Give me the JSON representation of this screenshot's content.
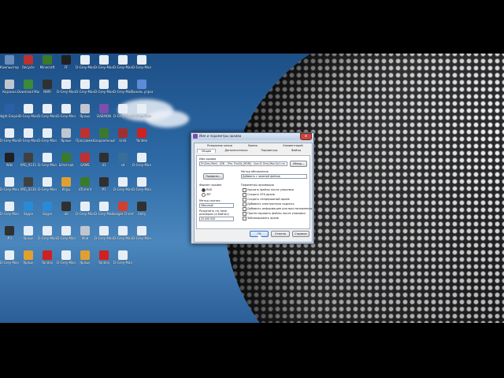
{
  "desktop": {
    "icons": [
      {
        "label": "Компьютер",
        "color": "#6b8fb8"
      },
      {
        "label": "Recycle",
        "color": "#c03030"
      },
      {
        "label": "Minecraft",
        "color": "#3b7a2a"
      },
      {
        "label": "FF",
        "color": "#202020"
      },
      {
        "label": "D-Grey-Man",
        "color": "#e8eef6"
      },
      {
        "label": "D-Grey-Man",
        "color": "#e8eef6"
      },
      {
        "label": "D-Grey-Man",
        "color": "#e8eef6"
      },
      {
        "label": "D-Grey-Man",
        "color": "#e8eef6"
      },
      {
        "label": "Корзина",
        "color": "#c0c6cf"
      },
      {
        "label": "Download Master",
        "color": "#3a8a3a"
      },
      {
        "label": "NWR",
        "color": "#303030"
      },
      {
        "label": "D-Grey-Man",
        "color": "#e8eef6"
      },
      {
        "label": "D-Grey-Man",
        "color": "#e8eef6"
      },
      {
        "label": "D-Grey-Man",
        "color": "#e8eef6"
      },
      {
        "label": "D-Grey-Man",
        "color": "#e8eef6"
      },
      {
        "label": "Панель управления",
        "color": "#5b8dd6"
      },
      {
        "label": "Night Empire",
        "color": "#2b5fa8"
      },
      {
        "label": "D-Grey-Man",
        "color": "#e8eef6"
      },
      {
        "label": "D-Grey-Man",
        "color": "#e8eef6"
      },
      {
        "label": "D-Grey-Man",
        "color": "#e8eef6"
      },
      {
        "label": "Ярлык",
        "color": "#c0c6cf"
      },
      {
        "label": "DAEMON",
        "color": "#7a4fb0"
      },
      {
        "label": "D-Grey-Man",
        "color": "#e8eef6"
      },
      {
        "label": "D-Grey-Man",
        "color": "#e8eef6"
      },
      {
        "label": "D-Grey-Man",
        "color": "#e8eef6"
      },
      {
        "label": "D-Grey-Man",
        "color": "#e8eef6"
      },
      {
        "label": "D-Grey-Man",
        "color": "#e8eef6"
      },
      {
        "label": "Ярлык",
        "color": "#c0c6cf"
      },
      {
        "label": "Программа",
        "color": "#c03030"
      },
      {
        "label": "Сохранённый",
        "color": "#3b7a2a"
      },
      {
        "label": "kraS",
        "color": "#a03030"
      },
      {
        "label": "Yandex",
        "color": "#d02020"
      },
      {
        "label": "Wiki",
        "color": "#202020"
      },
      {
        "label": "IMG_0135",
        "color": "#404040"
      },
      {
        "label": "D-Grey-Man",
        "color": "#e8eef6"
      },
      {
        "label": "Штатная",
        "color": "#3b7a2a"
      },
      {
        "label": "GAME",
        "color": "#c03030"
      },
      {
        "label": "d1",
        "color": "#303030"
      },
      {
        "label": "sd",
        "color": "#3a6e9a"
      },
      {
        "label": "D-Grey-Man",
        "color": "#e8eef6"
      },
      {
        "label": "D-Grey-Man",
        "color": "#e8eef6"
      },
      {
        "label": "IMG_0136",
        "color": "#404040"
      },
      {
        "label": "D-Grey-Man",
        "color": "#e8eef6"
      },
      {
        "label": "Игры",
        "color": "#e0a030"
      },
      {
        "label": "UTorrent",
        "color": "#3b7a2a"
      },
      {
        "label": "#1",
        "color": "#303030"
      },
      {
        "label": "D-Grey-Man",
        "color": "#e8eef6"
      },
      {
        "label": "D-Grey-Man",
        "color": "#e8eef6"
      },
      {
        "label": "D-Grey-Man",
        "color": "#e8eef6"
      },
      {
        "label": "Skype",
        "color": "#2a8ad6"
      },
      {
        "label": "Skype",
        "color": "#2a8ad6"
      },
      {
        "label": "dd",
        "color": "#303030"
      },
      {
        "label": "D-Grey-Man",
        "color": "#e8eef6"
      },
      {
        "label": "D-Grey-Man",
        "color": "#e8eef6"
      },
      {
        "label": "Google Chrome",
        "color": "#d04030"
      },
      {
        "label": "Unity",
        "color": "#303030"
      },
      {
        "label": "#3",
        "color": "#303030"
      },
      {
        "label": "Ярлык",
        "color": "#e8eef6"
      },
      {
        "label": "D-Grey-Man",
        "color": "#e8eef6"
      },
      {
        "label": "D-Grey-Man",
        "color": "#e8eef6"
      },
      {
        "label": "Мой",
        "color": "#c0c6cf"
      },
      {
        "label": "D-Grey-Man",
        "color": "#e8eef6"
      },
      {
        "label": "D-Grey-Man",
        "color": "#e8eef6"
      },
      {
        "label": "D-Grey-Man",
        "color": "#e8eef6"
      },
      {
        "label": "D-Grey-Man",
        "color": "#e8eef6"
      },
      {
        "label": "Ярлык",
        "color": "#e0a030"
      },
      {
        "label": "Yandex",
        "color": "#d02020"
      },
      {
        "label": "D-Grey-Man",
        "color": "#e8eef6"
      },
      {
        "label": "Ярлык",
        "color": "#e0a030"
      },
      {
        "label": "Yandex",
        "color": "#d02020"
      },
      {
        "label": "D-Grey-Man",
        "color": "#e8eef6"
      }
    ]
  },
  "dialog": {
    "title": "Имя и параметры архива",
    "close": "x",
    "tabs_row1": [
      "Резервные копии",
      "Время",
      "Комментарий"
    ],
    "tabs_row2": [
      "Общие",
      "Дополнительно",
      "Параметры",
      "Файлы"
    ],
    "archive_name_label": "Имя архива",
    "archive_name_value": "D:\\Grey-Man\\...\\DB ...\\Pro..Tra44t_[HDR]\\...\\kav-D-Grey-Man-Ep1.rar",
    "browse_button": "Обзор...",
    "profiles_button": "Профили...",
    "update_method_label": "Метод обновления",
    "update_method_value": "Добавить с заменой файлов",
    "format_label": "Формат архива",
    "format_options": [
      "RAR",
      "ZIP"
    ],
    "compression_label": "Метод сжатия",
    "compression_value": "Обычный",
    "split_label": "Разделить на тома размером (в байтах)",
    "split_value": "20 000 000",
    "archive_options_label": "Параметры архивации",
    "archive_options": [
      "Удалить файлы после упаковки",
      "Создать SFX-архив",
      "Создать непрерывный архив",
      "Добавить электронную подпись",
      "Добавить информацию для восстановления",
      "Протестировать файлы после упаковки",
      "Заблокировать архив"
    ],
    "ok_button": "OK",
    "cancel_button": "Отмена",
    "help_button": "Справка"
  }
}
